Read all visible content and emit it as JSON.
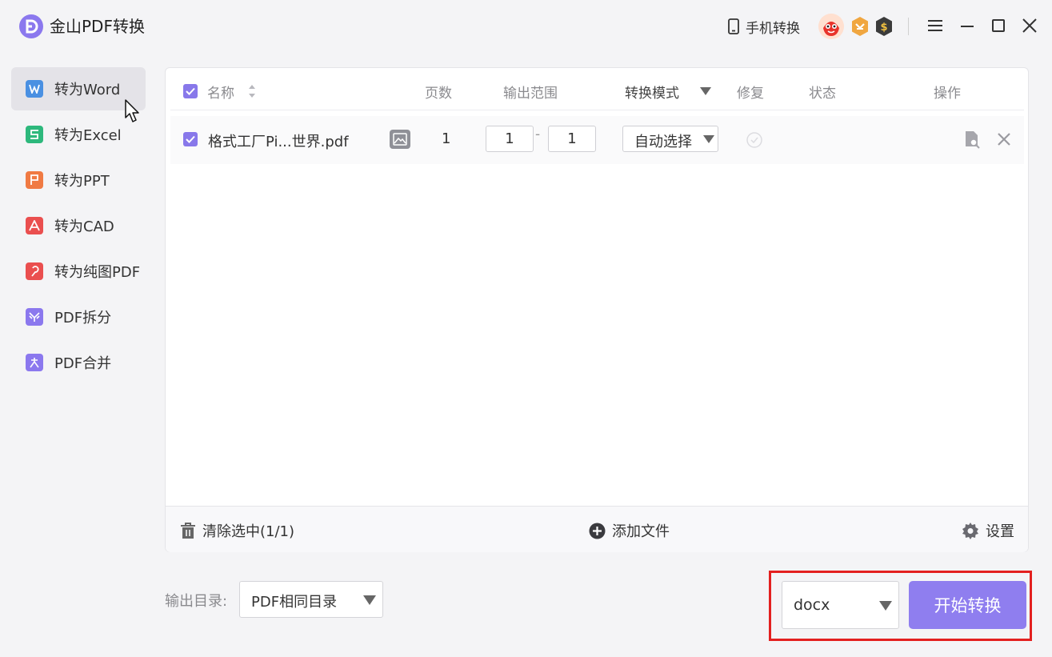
{
  "app": {
    "title": "金山PDF转换"
  },
  "header": {
    "mobile_label": "手机转换"
  },
  "sidebar": {
    "items": [
      {
        "label": "转为Word",
        "icon": "word-icon",
        "icon_char": "W",
        "color": "#4a90e2"
      },
      {
        "label": "转为Excel",
        "icon": "excel-icon",
        "icon_char": "S",
        "color": "#2db87c"
      },
      {
        "label": "转为PPT",
        "icon": "ppt-icon",
        "icon_char": "P",
        "color": "#f07a43"
      },
      {
        "label": "转为CAD",
        "icon": "cad-icon",
        "icon_char": "A",
        "color": "#ea4f4f"
      },
      {
        "label": "转为纯图PDF",
        "icon": "image-pdf-icon",
        "icon_char": "P",
        "color": "#ea4f4f"
      },
      {
        "label": "PDF拆分",
        "icon": "split-icon",
        "icon_char": "Y",
        "color": "#8b78ee"
      },
      {
        "label": "PDF合并",
        "icon": "merge-icon",
        "icon_char": "A",
        "color": "#8b78ee"
      }
    ],
    "active_index": 0
  },
  "table": {
    "headers": {
      "name": "名称",
      "pages": "页数",
      "range": "输出范围",
      "mode": "转换模式",
      "repair": "修复",
      "status": "状态",
      "actions": "操作"
    },
    "rows": [
      {
        "checked": true,
        "name": "格式工厂Pi...世界.pdf",
        "pages": "1",
        "range_from": "1",
        "range_to": "1",
        "range_sep": "-",
        "mode": "自动选择",
        "status": ""
      }
    ]
  },
  "footer": {
    "clear_label": "清除选中(1/1)",
    "add_label": "添加文件",
    "settings_label": "设置"
  },
  "bottom": {
    "output_label": "输出目录:",
    "output_value": "PDF相同目录",
    "format_value": "docx",
    "start_label": "开始转换"
  },
  "colors": {
    "accent": "#8f7eef",
    "highlight": "#e3201f"
  }
}
